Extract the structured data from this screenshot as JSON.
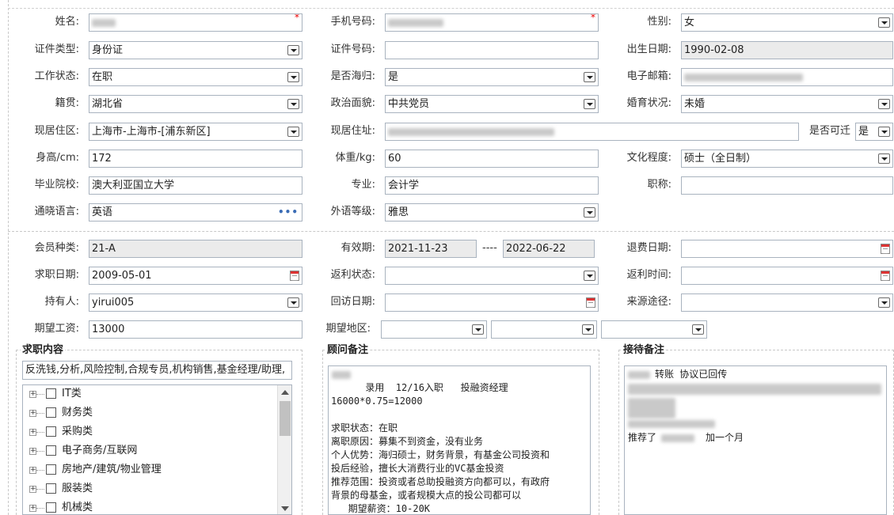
{
  "basic": {
    "name": {
      "label": "姓名:",
      "value": ""
    },
    "phone": {
      "label": "手机号码:",
      "value": ""
    },
    "gender": {
      "label": "性别:",
      "value": "女"
    },
    "id_type": {
      "label": "证件类型:",
      "value": "身份证"
    },
    "id_number": {
      "label": "证件号码:",
      "value": ""
    },
    "birth_date": {
      "label": "出生日期:",
      "value": "1990-02-08"
    },
    "work_status": {
      "label": "工作状态:",
      "value": "在职"
    },
    "returnee": {
      "label": "是否海归:",
      "value": "是"
    },
    "email": {
      "label": "电子邮箱:",
      "value": ""
    },
    "native_place": {
      "label": "籍贯:",
      "value": "湖北省"
    },
    "political": {
      "label": "政治面貌:",
      "value": "中共党员"
    },
    "marital": {
      "label": "婚育状况:",
      "value": "未婚"
    },
    "residence_area": {
      "label": "现居住区:",
      "value": "上海市-上海市-[浦东新区]"
    },
    "residence_addr": {
      "label": "现居住址:",
      "value": ""
    },
    "relocate": {
      "label": "是否可迁",
      "value": "是"
    },
    "height": {
      "label": "身高/cm:",
      "value": "172"
    },
    "weight": {
      "label": "体重/kg:",
      "value": "60"
    },
    "education": {
      "label": "文化程度:",
      "value": "硕士（全日制）"
    },
    "school": {
      "label": "毕业院校:",
      "value": "澳大利亚国立大学"
    },
    "major": {
      "label": "专业:",
      "value": "会计学"
    },
    "title": {
      "label": "职称:",
      "value": ""
    },
    "language": {
      "label": "通晓语言:",
      "value": "英语"
    },
    "lang_level": {
      "label": "外语等级:",
      "value": "雅思"
    }
  },
  "member": {
    "type": {
      "label": "会员种类:",
      "value": "21-A"
    },
    "valid": {
      "label": "有效期:",
      "from": "2021-11-23",
      "sep": "----",
      "to": "2022-06-22"
    },
    "refund_date": {
      "label": "退费日期:",
      "value": ""
    },
    "job_date": {
      "label": "求职日期:",
      "value": "2009-05-01"
    },
    "rebate_status": {
      "label": "返利状态:",
      "value": ""
    },
    "rebate_time": {
      "label": "返利时间:",
      "value": ""
    },
    "holder": {
      "label": "持有人:",
      "value": "yirui005"
    },
    "visit_date": {
      "label": "回访日期:",
      "value": ""
    },
    "source": {
      "label": "来源途径:",
      "value": ""
    },
    "salary": {
      "label": "期望工资:",
      "value": "13000"
    },
    "region": {
      "label": "期望地区:"
    }
  },
  "job_content": {
    "title": "求职内容",
    "summary": "反洗钱,分析,风险控制,合规专员,机构销售,基金经理/助理,",
    "tree": [
      "IT类",
      "财务类",
      "采购类",
      "电子商务/互联网",
      "房地产/建筑/物业管理",
      "服装类",
      "机械类"
    ]
  },
  "consultant_note": {
    "title": "顾问备注",
    "text": "    录用  12/16入职   投融资经理\n16000*0.75=12000\n\n求职状态：在职\n离职原因：募集不到资金，没有业务\n个人优势：海归硕士，财务背景，有基金公司投资和\n投后经验，擅长大消费行业的VC基金投资\n推荐范围：投资或者总助投融资方向都可以，有政府\n背景的母基金，或者规模大点的投公司都可以\n   期望薪资：10-20K"
  },
  "reception_note": {
    "title": "接待备注",
    "line1": "转账 协议已回传",
    "last_prefix": "推荐了",
    "last_suffix": "加一个月"
  }
}
